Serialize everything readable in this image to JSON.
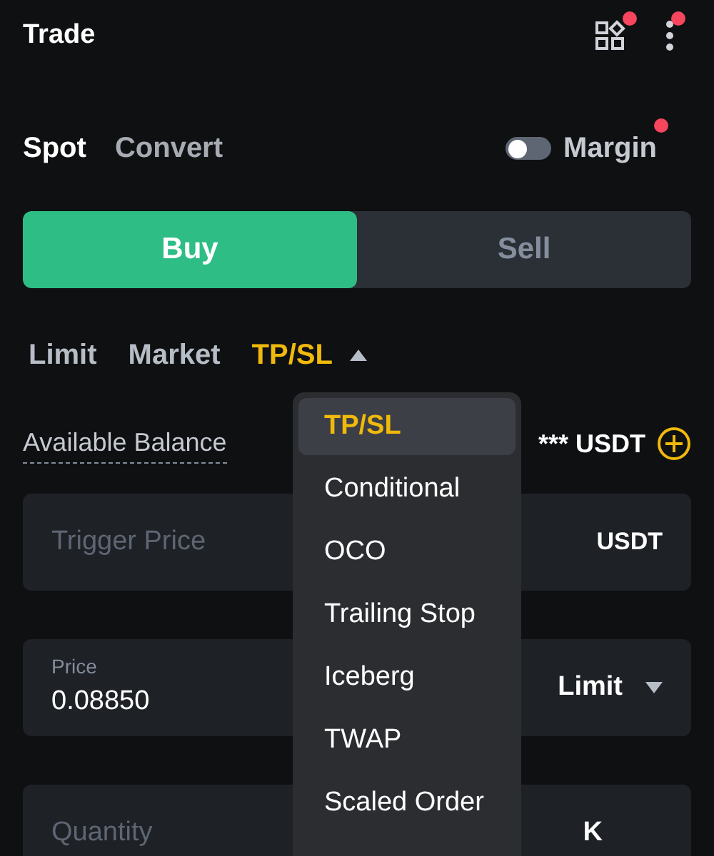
{
  "header": {
    "title": "Trade",
    "apps_badge": true,
    "more_badge": true
  },
  "mode_tabs": [
    {
      "label": "Spot",
      "selected": true
    },
    {
      "label": "Convert",
      "selected": false
    }
  ],
  "margin": {
    "label": "Margin",
    "on": false,
    "badge": true
  },
  "sides": [
    {
      "label": "Buy",
      "selected": true
    },
    {
      "label": "Sell",
      "selected": false
    }
  ],
  "order_types": [
    {
      "label": "Limit",
      "selected": false
    },
    {
      "label": "Market",
      "selected": false
    },
    {
      "label": "TP/SL",
      "selected": true,
      "expanded": true
    }
  ],
  "balance": {
    "label": "Available Balance",
    "value": "*** USDT"
  },
  "trigger_field": {
    "placeholder": "Trigger Price",
    "unit": "USDT"
  },
  "price_field": {
    "label": "Price",
    "value": "0.08850",
    "type": "Limit"
  },
  "quantity_field": {
    "placeholder": "Quantity",
    "unit": "K"
  },
  "dropdown": [
    {
      "label": "TP/SL",
      "selected": true
    },
    {
      "label": "Conditional",
      "selected": false
    },
    {
      "label": "OCO",
      "selected": false
    },
    {
      "label": "Trailing Stop",
      "selected": false
    },
    {
      "label": "Iceberg",
      "selected": false
    },
    {
      "label": "TWAP",
      "selected": false
    },
    {
      "label": "Scaled Order",
      "selected": false
    }
  ]
}
